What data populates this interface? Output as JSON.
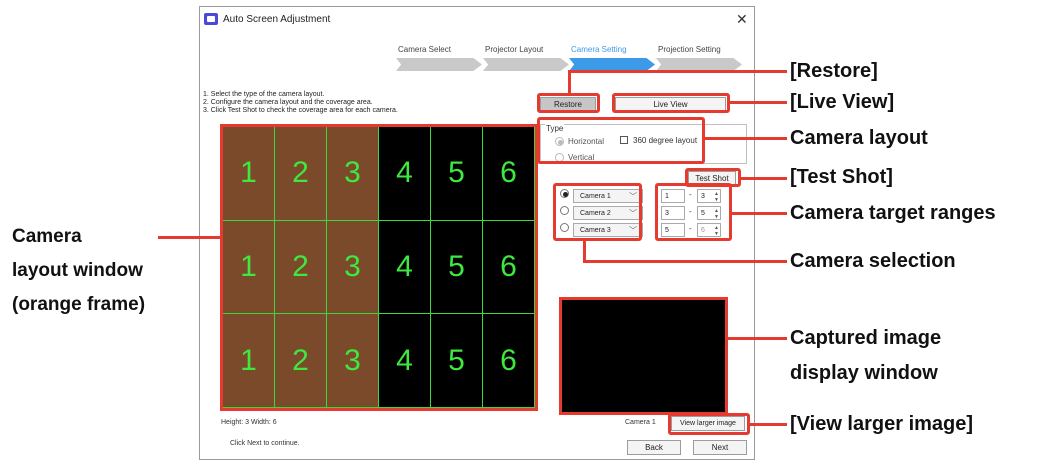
{
  "window": {
    "title": "Auto Screen Adjustment",
    "close_glyph": "✕"
  },
  "steps": [
    {
      "label": "Camera Select",
      "active": false
    },
    {
      "label": "Projector Layout",
      "active": false
    },
    {
      "label": "Camera Setting",
      "active": true
    },
    {
      "label": "Projection Setting",
      "active": false
    }
  ],
  "instructions": [
    "1. Select the type of the camera layout.",
    "2. Configure the camera layout and the coverage area.",
    "3. Click Test Shot to check the coverage area for each camera."
  ],
  "grid": {
    "rows": [
      [
        "1",
        "2",
        "3",
        "4",
        "5",
        "6"
      ],
      [
        "1",
        "2",
        "3",
        "4",
        "5",
        "6"
      ],
      [
        "1",
        "2",
        "3",
        "4",
        "5",
        "6"
      ]
    ],
    "highlighted_columns": 3,
    "highlight_color": "#7b4a2a",
    "line_color": "#3cd93c"
  },
  "buttons": {
    "restore": "Restore",
    "live_view": "Live View",
    "test_shot": "Test Shot",
    "view_larger": "View larger image",
    "back": "Back",
    "next": "Next"
  },
  "type_panel": {
    "title": "Type",
    "horizontal": "Horizontal",
    "vertical": "Vertical",
    "layout_360": "360 degree layout"
  },
  "cameras": [
    {
      "label": "Camera 1",
      "selected": true,
      "from": "1",
      "to": "3",
      "to_disabled": false
    },
    {
      "label": "Camera 2",
      "selected": false,
      "from": "3",
      "to": "5",
      "to_disabled": false
    },
    {
      "label": "Camera 3",
      "selected": false,
      "from": "5",
      "to": "6",
      "to_disabled": true
    }
  ],
  "range_separator": "-",
  "status": {
    "size": "Height: 3  Width: 6",
    "current_camera": "Camera 1",
    "hint": "Click Next to continue."
  },
  "callouts": {
    "restore": "[Restore]",
    "live_view": "[Live View]",
    "camera_layout": "Camera layout",
    "test_shot": "[Test Shot]",
    "target_ranges": "Camera target ranges",
    "selection": "Camera selection",
    "captured_1": "Captured image",
    "captured_2": "display window",
    "view_larger": "[View larger image]",
    "left_1": "Camera",
    "left_2": "layout window",
    "left_3": "(orange frame)"
  },
  "annotation_color": "#e53a2f"
}
